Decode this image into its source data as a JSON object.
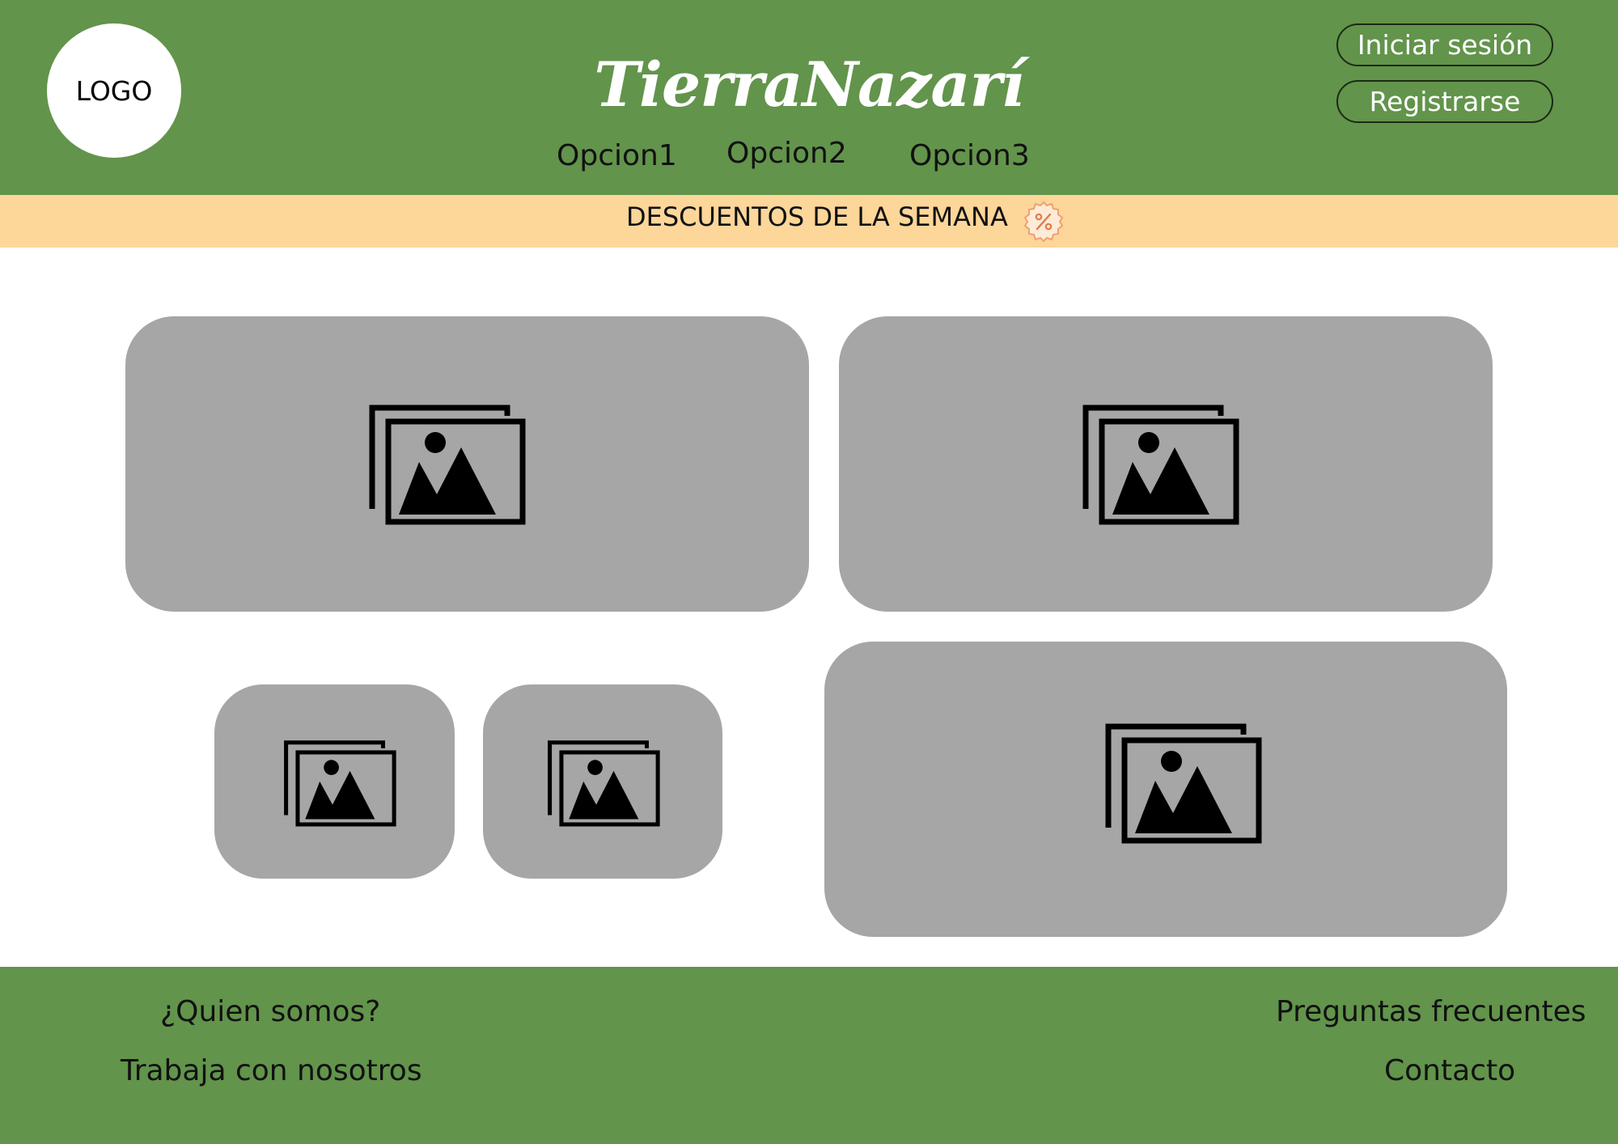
{
  "header": {
    "logo_text": "LOGO",
    "brand": "TierraNazarí",
    "nav": [
      "Opcion1",
      "Opcion2",
      "Opcion3"
    ],
    "login_label": "Iniciar sesión",
    "register_label": "Registrarse"
  },
  "discount_bar": {
    "text": "DESCUENTOS DE LA SEMANA",
    "icon": "percent-badge-icon"
  },
  "cards": [
    {
      "icon": "image-gallery-icon"
    },
    {
      "icon": "image-gallery-icon"
    },
    {
      "icon": "image-gallery-icon"
    },
    {
      "icon": "image-gallery-icon"
    },
    {
      "icon": "image-gallery-icon"
    }
  ],
  "footer": {
    "about": "¿Quien somos?",
    "jobs": "Trabaja con nosotros",
    "faq": "Preguntas frecuentes",
    "contact": "Contacto"
  },
  "colors": {
    "header_bg": "#62944b",
    "discount_bg": "#fdd699",
    "card_bg": "#a6a6a6",
    "footer_bg": "#62944b",
    "badge_color": "#f0a070"
  }
}
